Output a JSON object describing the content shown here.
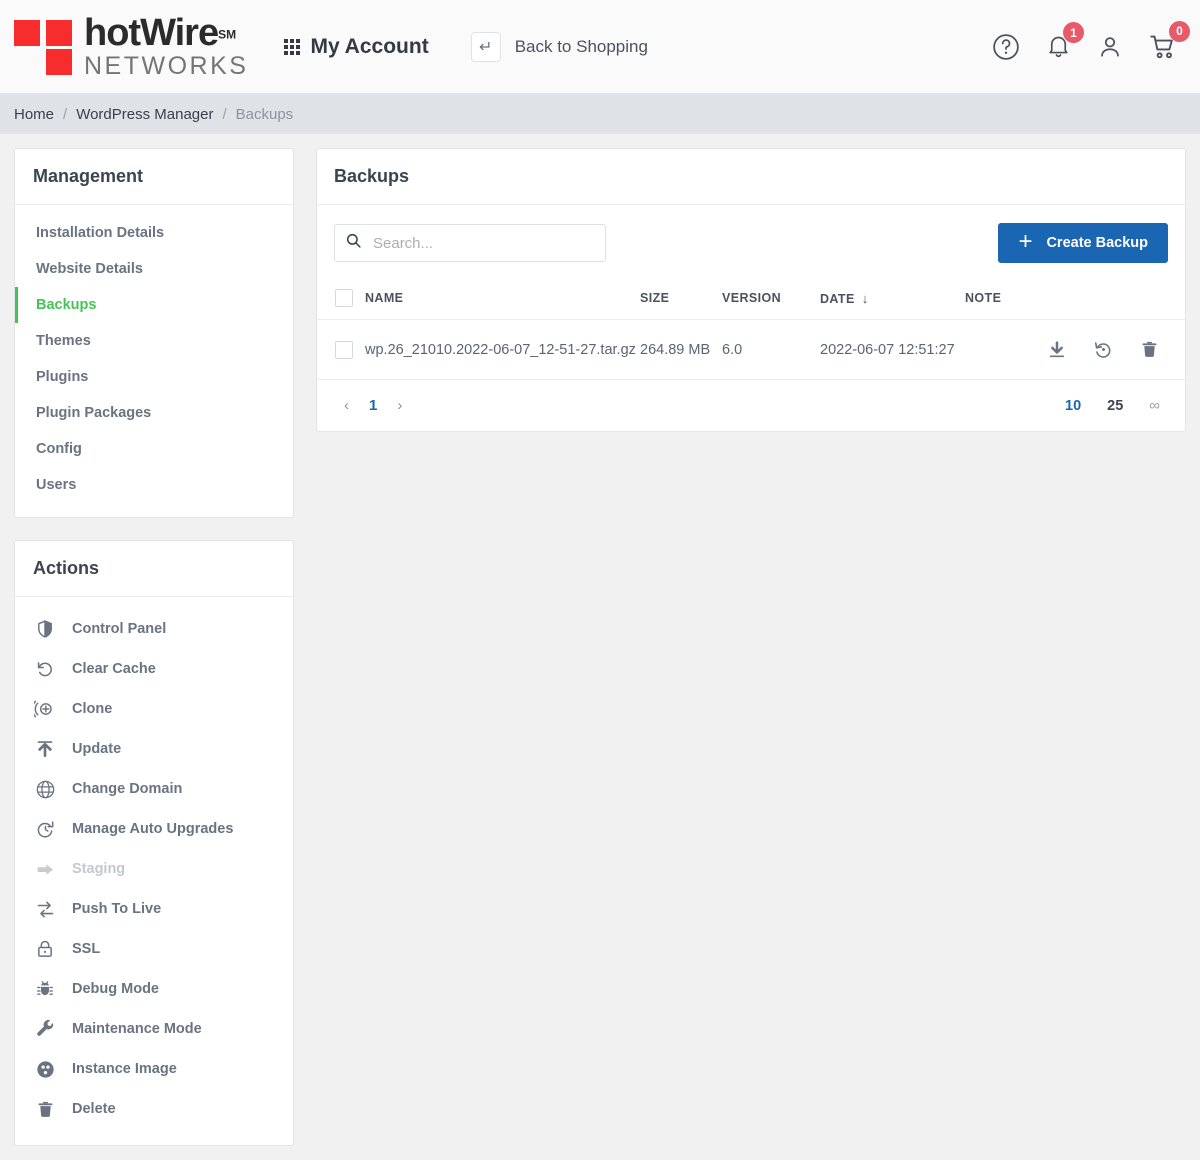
{
  "header": {
    "logo": {
      "top": "hotWire",
      "sm": "SM",
      "bottom": "NETWORKS",
      "color": "#f72d2d"
    },
    "my_account": "My Account",
    "back_to_shopping": "Back to Shopping",
    "icons": {
      "help": "help-circle-icon",
      "bell": "bell-icon",
      "user": "user-icon",
      "cart": "cart-icon",
      "grid": "grid-icon",
      "return": "return-arrow-icon"
    },
    "notification_count": "1",
    "cart_count": "0",
    "badge_color": "#e8596a"
  },
  "breadcrumb": {
    "items": [
      {
        "label": "Home",
        "current": false
      },
      {
        "label": "WordPress Manager",
        "current": false
      },
      {
        "label": "Backups",
        "current": true
      }
    ],
    "separator": "/"
  },
  "sidebar": {
    "management": {
      "title": "Management",
      "active_color": "#45c455",
      "items": [
        {
          "label": "Installation Details",
          "active": false
        },
        {
          "label": "Website Details",
          "active": false
        },
        {
          "label": "Backups",
          "active": true
        },
        {
          "label": "Themes",
          "active": false
        },
        {
          "label": "Plugins",
          "active": false
        },
        {
          "label": "Plugin Packages",
          "active": false
        },
        {
          "label": "Config",
          "active": false
        },
        {
          "label": "Users",
          "active": false
        }
      ]
    },
    "actions": {
      "title": "Actions",
      "items": [
        {
          "label": "Control Panel",
          "icon": "shield-icon",
          "disabled": false
        },
        {
          "label": "Clear Cache",
          "icon": "clear-cache-icon",
          "disabled": false
        },
        {
          "label": "Clone",
          "icon": "clone-icon",
          "disabled": false
        },
        {
          "label": "Update",
          "icon": "upload-arrow-icon",
          "disabled": false
        },
        {
          "label": "Change Domain",
          "icon": "globe-icon",
          "disabled": false
        },
        {
          "label": "Manage Auto Upgrades",
          "icon": "history-clock-icon",
          "disabled": false
        },
        {
          "label": "Staging",
          "icon": "arrow-right-icon",
          "disabled": true
        },
        {
          "label": "Push To Live",
          "icon": "exchange-arrows-icon",
          "disabled": false
        },
        {
          "label": "SSL",
          "icon": "lock-icon",
          "disabled": false
        },
        {
          "label": "Debug Mode",
          "icon": "bug-icon",
          "disabled": false
        },
        {
          "label": "Maintenance Mode",
          "icon": "wrench-icon",
          "disabled": false
        },
        {
          "label": "Instance Image",
          "icon": "instance-image-icon",
          "disabled": false
        },
        {
          "label": "Delete",
          "icon": "trash-icon",
          "disabled": false
        }
      ]
    }
  },
  "main": {
    "title": "Backups",
    "search": {
      "value": "",
      "placeholder": "Search...",
      "icon": "search-icon"
    },
    "create_button": {
      "label": "Create Backup",
      "icon": "plus-icon",
      "color": "#1a66b3"
    },
    "table": {
      "columns": [
        "NAME",
        "SIZE",
        "VERSION",
        "DATE",
        "NOTE"
      ],
      "sort_column": "DATE",
      "sort_arrow": "↓",
      "rows": [
        {
          "name": "wp.26_21010.2022-06-07_12-51-27.tar.gz",
          "size": "264.89 MB",
          "version": "6.0",
          "date": "2022-06-07 12:51:27",
          "note": "",
          "actions": [
            "download-icon",
            "restore-icon",
            "trash-icon"
          ]
        }
      ]
    },
    "pagination": {
      "prev": "‹",
      "next": "›",
      "pages": [
        "1"
      ],
      "current_page": "1",
      "per_page_options": [
        "10",
        "25",
        "∞"
      ],
      "per_page_selected": "10"
    }
  }
}
